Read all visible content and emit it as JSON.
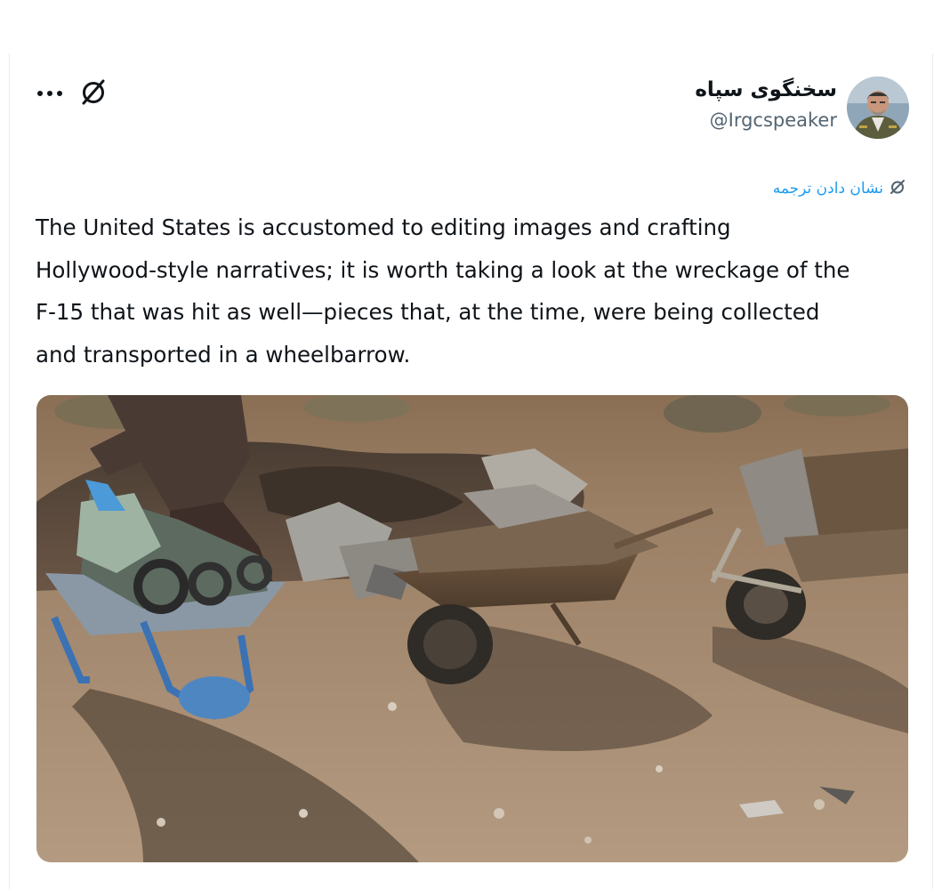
{
  "tweet": {
    "author": {
      "display_name": "سخنگوی سپاه",
      "handle": "@Irgcspeaker",
      "avatar_icon": "avatar-photo"
    },
    "actions": {
      "more_icon": "more-horizontal-icon",
      "grok_icon": "grok-icon"
    },
    "translate": {
      "label": "نشان دادن ترجمه",
      "icon": "grok-icon"
    },
    "text_lines": [
      "The United States is accustomed to editing images and crafting",
      "Hollywood-style narratives; it is worth taking a look at the wreckage of the",
      "F-15 that was hit as well—pieces that, at the time, were being collected",
      "and transported in a wheelbarrow."
    ],
    "media": {
      "type": "photo"
    }
  },
  "colors": {
    "text": "#0f1419",
    "secondary_text": "#536471",
    "link": "#1d9bf0",
    "background": "#ffffff"
  }
}
